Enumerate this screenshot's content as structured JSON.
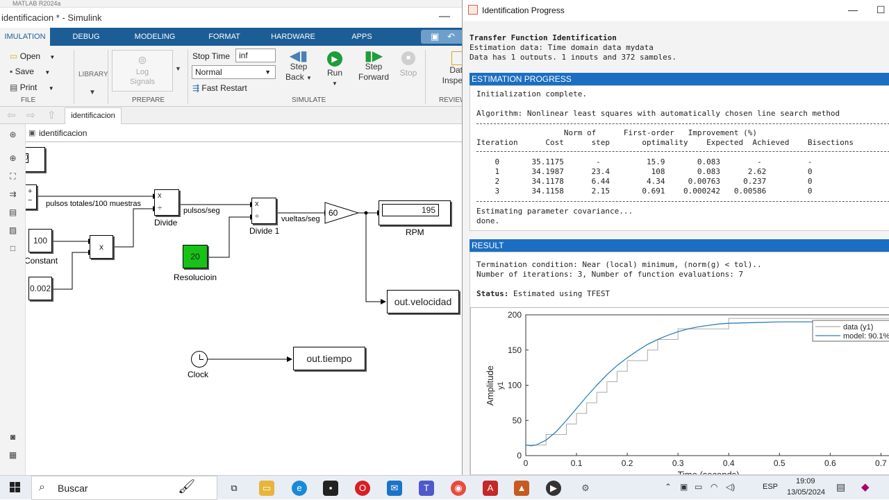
{
  "simulink": {
    "matlab_title": "MATLAB R2024a",
    "window_title": "identificacion * - Simulink",
    "ribbon_tabs": [
      "IMULATION",
      "DEBUG",
      "MODELING",
      "FORMAT",
      "HARDWARE",
      "APPS"
    ],
    "file_section": {
      "open": "Open",
      "save": "Save",
      "print": "Print",
      "label": "FILE"
    },
    "library_label": "LIBRARY",
    "prepare": {
      "log_signals_1": "Log",
      "log_signals_2": "Signals",
      "label": "PREPARE"
    },
    "simulate": {
      "stop_time_label": "Stop Time",
      "stop_time_value": "inf",
      "mode_value": "Normal",
      "fast_restart": "Fast Restart",
      "step_back_1": "Step",
      "step_back_2": "Back",
      "run": "Run",
      "step_forward_1": "Step",
      "step_forward_2": "Forward",
      "stop": "Stop",
      "label": "SIMULATE"
    },
    "review": {
      "data_1": "Dat",
      "data_2": "Inspe",
      "label": "REVIEW"
    },
    "model_tab": "identificacion",
    "breadcrumb": "identificacion",
    "blocks": {
      "top_partial_value": "0",
      "divide_label": "Divide",
      "divide1_label": "Divide 1",
      "constant_value": "100",
      "constant_label": "Constant",
      "small_const_value": "0.002",
      "resolucion_value": "20",
      "resolucion_label": "Resolucioin",
      "gain_value": "60",
      "rpm_value": "195",
      "rpm_label": "RPM",
      "out_velocidad": "out.velocidad",
      "out_tiempo": "out.tiempo",
      "clock_label": "Clock",
      "signal_pulsos": "pulsos totales/100 muestras",
      "signal_pulsos_seg": "pulsos/seg",
      "signal_vueltas": "vueltas/seg",
      "mult_symbol": "x",
      "div_symbol": "÷",
      "plus": "+",
      "minus": "−"
    }
  },
  "idprogress": {
    "window_title": "Identification Progress",
    "head_line1": "Transfer Function Identification",
    "head_line2": "Estimation data: Time domain data mydata",
    "head_line3": "Data has 1 outputs, 1 inputs and 372 samples.",
    "estimation_header": "ESTIMATION PROGRESS",
    "init_line": "Initialization complete.",
    "algorithm_line": "Algorithm: Nonlinear least squares with automatically chosen line search method",
    "table_header1": "                   Norm of      First-order   Improvement (%)",
    "table_header2": "Iteration      Cost      step       optimality    Expected  Achieved    Bisections",
    "rows": [
      "    0       35.1175       -          15.9       0.083        -          -",
      "    1       34.1987      23.4         108       0.083      2.62         0",
      "    2       34.1178      6.44        4.34     0.00763     0.237         0",
      "    3       34.1158      2.15       0.691    0.000242   0.00586         0"
    ],
    "covariance_line": "Estimating parameter covariance...",
    "done_line": "done.",
    "result_header": "RESULT",
    "termination_line": "Termination condition: Near (local) minimum, (norm(g) < tol)..",
    "iterations_line": "Number of iterations: 3, Number of function evaluations: 7",
    "status_label": "Status:",
    "status_value": "Estimated using TFEST"
  },
  "chart_data": {
    "type": "line",
    "xlabel": "Time (seconds)",
    "ylabel": "Amplitude",
    "ylabel2": "y1",
    "xlim": [
      0,
      0.72
    ],
    "ylim": [
      0,
      200
    ],
    "xticks": [
      0,
      0.1,
      0.2,
      0.3,
      0.4,
      0.5,
      0.6,
      0.7
    ],
    "yticks": [
      0,
      50,
      100,
      150,
      200
    ],
    "legend_position": "top-right",
    "series": [
      {
        "name": "data (y1)",
        "color": "#aaaaaa",
        "x": [
          0,
          0.02,
          0.04,
          0.06,
          0.08,
          0.1,
          0.12,
          0.14,
          0.16,
          0.18,
          0.2,
          0.22,
          0.24,
          0.26,
          0.28,
          0.3,
          0.32,
          0.34,
          0.36,
          0.38,
          0.4,
          0.45,
          0.5,
          0.55,
          0.6,
          0.65,
          0.7,
          0.72
        ],
        "y": [
          15,
          15,
          30,
          30,
          45,
          60,
          75,
          90,
          105,
          120,
          135,
          135,
          150,
          165,
          165,
          180,
          180,
          180,
          180,
          180,
          195,
          195,
          195,
          195,
          195,
          195,
          195,
          195
        ]
      },
      {
        "name": "model: 90.1%",
        "color": "#2e7fb8",
        "x": [
          0,
          0.01,
          0.02,
          0.04,
          0.06,
          0.08,
          0.1,
          0.12,
          0.14,
          0.16,
          0.18,
          0.2,
          0.22,
          0.24,
          0.26,
          0.28,
          0.3,
          0.32,
          0.34,
          0.36,
          0.38,
          0.4,
          0.45,
          0.5,
          0.55,
          0.6,
          0.65,
          0.7,
          0.72
        ],
        "y": [
          15,
          14,
          15,
          22,
          34,
          50,
          67,
          84,
          100,
          115,
          128,
          139,
          149,
          158,
          165,
          171,
          176,
          180,
          183,
          185,
          187,
          188,
          189,
          190,
          190,
          190,
          190,
          190,
          190
        ]
      }
    ]
  },
  "taskbar": {
    "search_placeholder": "Buscar",
    "language": "ESP",
    "time": "19:09",
    "date": "13/05/2024"
  }
}
